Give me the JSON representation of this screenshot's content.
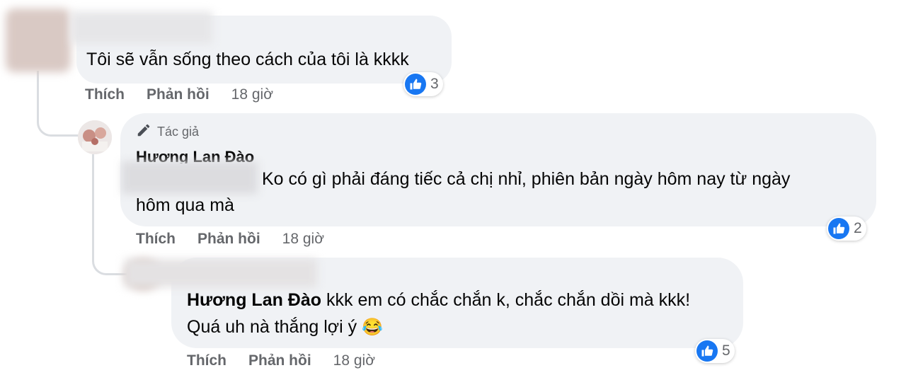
{
  "comments": [
    {
      "text": "Tôi sẽ vẫn sống theo cách của tôi là kkkk",
      "actions": {
        "like": "Thích",
        "reply": "Phản hồi",
        "time": "18 giờ"
      },
      "reaction_count": "3"
    },
    {
      "author_badge": "Tác giả",
      "author": "Hương Lan Đào",
      "text_line1": "Ko có gì phải đáng tiếc cả chị nhỉ, phiên bản ngày hôm nay từ ngày",
      "text_line2": "hôm qua mà",
      "actions": {
        "like": "Thích",
        "reply": "Phản hồi",
        "time": "18 giờ"
      },
      "reaction_count": "2"
    },
    {
      "mention": "Hương Lan Đào",
      "text_line1": " kkk em có chắc chắn k, chắc chắn dồi mà kkk!",
      "text_line2": "Quá uh nà thắng lợi ý",
      "emoji": "😂",
      "actions": {
        "like": "Thích",
        "reply": "Phản hồi",
        "time": "18 giờ"
      },
      "reaction_count": "5"
    }
  ],
  "colors": {
    "bubble": "#f0f2f5",
    "like_blue": "#1877f2",
    "meta_gray": "#65676b"
  }
}
